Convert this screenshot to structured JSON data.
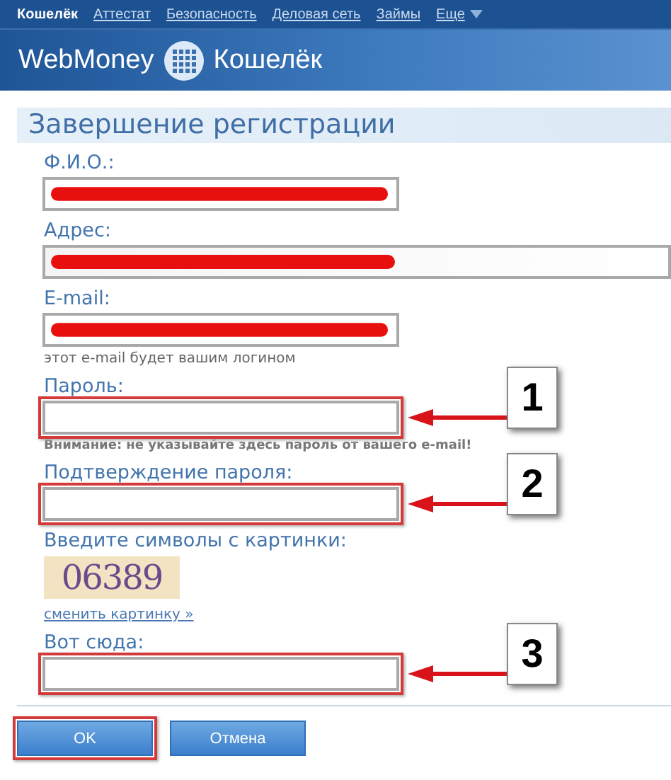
{
  "top_nav": [
    {
      "label": "Кошелёк",
      "selected": true
    },
    {
      "label": "Аттестат",
      "selected": false
    },
    {
      "label": "Безопасность",
      "selected": false
    },
    {
      "label": "Деловая сеть",
      "selected": false
    },
    {
      "label": "Займы",
      "selected": false
    },
    {
      "label": "Еще",
      "selected": false,
      "dropdown": true
    }
  ],
  "header": {
    "brand": "WebMoney",
    "product": "Кошелёк"
  },
  "form": {
    "title": "Завершение регистрации",
    "fields": [
      {
        "label": "Ф.И.О.:",
        "redacted": true,
        "wide": false,
        "highlighted": false
      },
      {
        "label": "Адрес:",
        "redacted": true,
        "wide": true,
        "highlighted": false
      },
      {
        "label": "E-mail:",
        "redacted": true,
        "wide": false,
        "highlighted": false,
        "hint": "этот e-mail будет вашим логином",
        "hint_bold": false
      },
      {
        "label": "Пароль:",
        "redacted": false,
        "wide": false,
        "highlighted": true,
        "callout": "1",
        "hint": "Внимание: не указывайте здесь пароль от вашего e-mail!",
        "hint_bold": true
      },
      {
        "label": "Подтверждение пароля:",
        "redacted": false,
        "wide": false,
        "highlighted": true,
        "callout": "2"
      }
    ],
    "captcha": {
      "label": "Введите символы с картинки:",
      "code": "06389",
      "refresh_link": "сменить картинку »"
    },
    "captcha_field": {
      "label": "Вот сюда:",
      "highlighted": true,
      "callout": "3"
    },
    "buttons": [
      {
        "label": "OK",
        "highlighted": true
      },
      {
        "label": "Отмена",
        "highlighted": false
      }
    ]
  }
}
